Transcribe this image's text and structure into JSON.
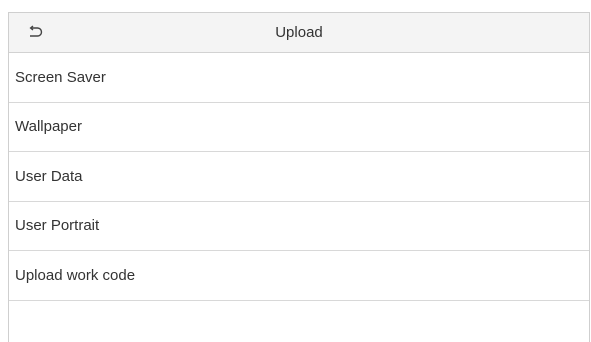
{
  "header": {
    "title": "Upload",
    "back_icon": "back-arrow-icon"
  },
  "menu": {
    "items": [
      {
        "label": "Screen Saver"
      },
      {
        "label": "Wallpaper"
      },
      {
        "label": "User Data"
      },
      {
        "label": "User Portrait"
      },
      {
        "label": "Upload work code"
      }
    ]
  }
}
